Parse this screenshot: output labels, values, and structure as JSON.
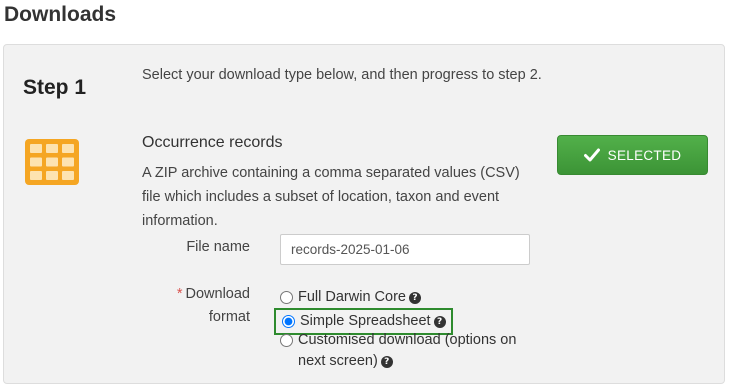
{
  "page": {
    "title": "Downloads"
  },
  "step": {
    "label": "Step 1",
    "description": "Select your download type below, and then progress to step 2."
  },
  "occurrence": {
    "icon": "table-grid-icon",
    "title": "Occurrence records",
    "description": "A ZIP archive containing a comma separated values (CSV) file which includes a subset of location, taxon and event information.",
    "selected_button": {
      "label": "SELECTED",
      "icon": "checkmark-icon"
    }
  },
  "file_name": {
    "label": "File name",
    "value": "records-2025-01-06"
  },
  "download_format": {
    "required_marker": "*",
    "label_line1": "Download",
    "label_line2": "format",
    "options": [
      {
        "label": "Full Darwin Core",
        "selected": false,
        "help_icon": "question-circle-icon"
      },
      {
        "label": "Simple Spreadsheet",
        "selected": true,
        "help_icon": "question-circle-icon"
      },
      {
        "label": "Customised download (options on next screen)",
        "selected": false,
        "help_icon": "question-circle-icon"
      }
    ]
  },
  "colors": {
    "accent_green": "#3c9436",
    "icon_orange": "#f5a623",
    "required_red": "#d9534f",
    "highlight_border": "#2e8b2e"
  }
}
